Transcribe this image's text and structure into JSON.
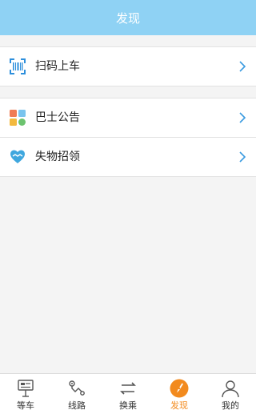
{
  "header": {
    "title": "发现"
  },
  "groups": [
    {
      "items": [
        {
          "label": "扫码上车",
          "icon": "qr-scan-icon"
        }
      ]
    },
    {
      "items": [
        {
          "label": "巴士公告",
          "icon": "announcement-grid-icon"
        },
        {
          "label": "失物招领",
          "icon": "heart-hands-icon"
        }
      ]
    }
  ],
  "tabbar": {
    "items": [
      {
        "label": "等车",
        "icon": "bus-stop-icon"
      },
      {
        "label": "线路",
        "icon": "route-icon"
      },
      {
        "label": "换乘",
        "icon": "transfer-icon"
      },
      {
        "label": "发现",
        "icon": "discover-icon",
        "active": true
      },
      {
        "label": "我的",
        "icon": "profile-icon"
      }
    ]
  },
  "colors": {
    "header": "#8fd2f4",
    "accent": "#f28a1e",
    "chevron": "#3a9be0"
  }
}
